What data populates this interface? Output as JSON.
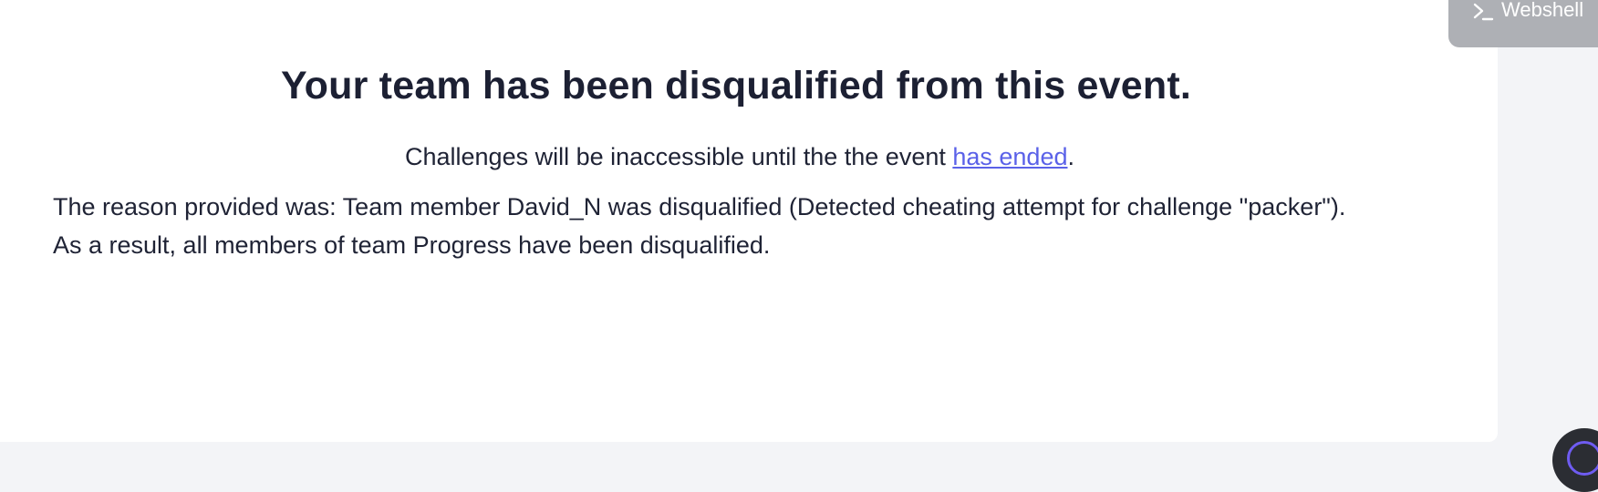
{
  "heading": "Your team has been disqualified from this event.",
  "subtitle": {
    "before_link": "Challenges will be inaccessible until the the event ",
    "link_text": "has ended",
    "after_link": "."
  },
  "reason": {
    "line1": "The reason provided was: Team member David_N was disqualified (Detected cheating attempt for challenge \"packer\").",
    "line2": "As a result, all members of team Progress have been disqualified."
  },
  "webshell": {
    "label": "Webshell",
    "icon": "terminal-icon"
  },
  "colors": {
    "link": "#5a61e8",
    "text": "#1f2335",
    "webshell_bg": "#aeb0b5",
    "fab_accent": "#6f5cf2"
  }
}
